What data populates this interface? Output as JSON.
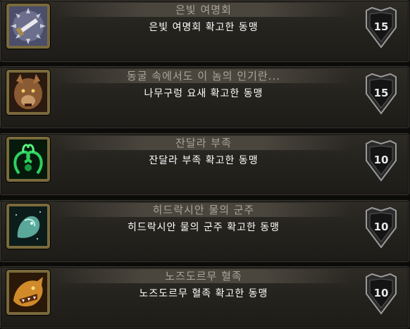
{
  "achievements": [
    {
      "title": "은빛 여명회",
      "description": "은빛 여명회 확고한 동맹",
      "points": "15",
      "icon": "sword-icon"
    },
    {
      "title": "동굴 속에서도 이 놈의 인기란...",
      "description": "나무구렁 요새 확고한 동맹",
      "points": "15",
      "icon": "wolf-head-icon"
    },
    {
      "title": "잔달라 부족",
      "description": "잔달라 부족 확고한 동맹",
      "points": "10",
      "icon": "snake-emblem-icon"
    },
    {
      "title": "히드락시안 물의 군주",
      "description": "히드락시안 물의 군주 확고한 동맹",
      "points": "10",
      "icon": "water-elemental-icon"
    },
    {
      "title": "노즈도르무 혈족",
      "description": "노즈도르무 혈족 확고한 동맹",
      "points": "10",
      "icon": "dragon-head-icon"
    }
  ]
}
